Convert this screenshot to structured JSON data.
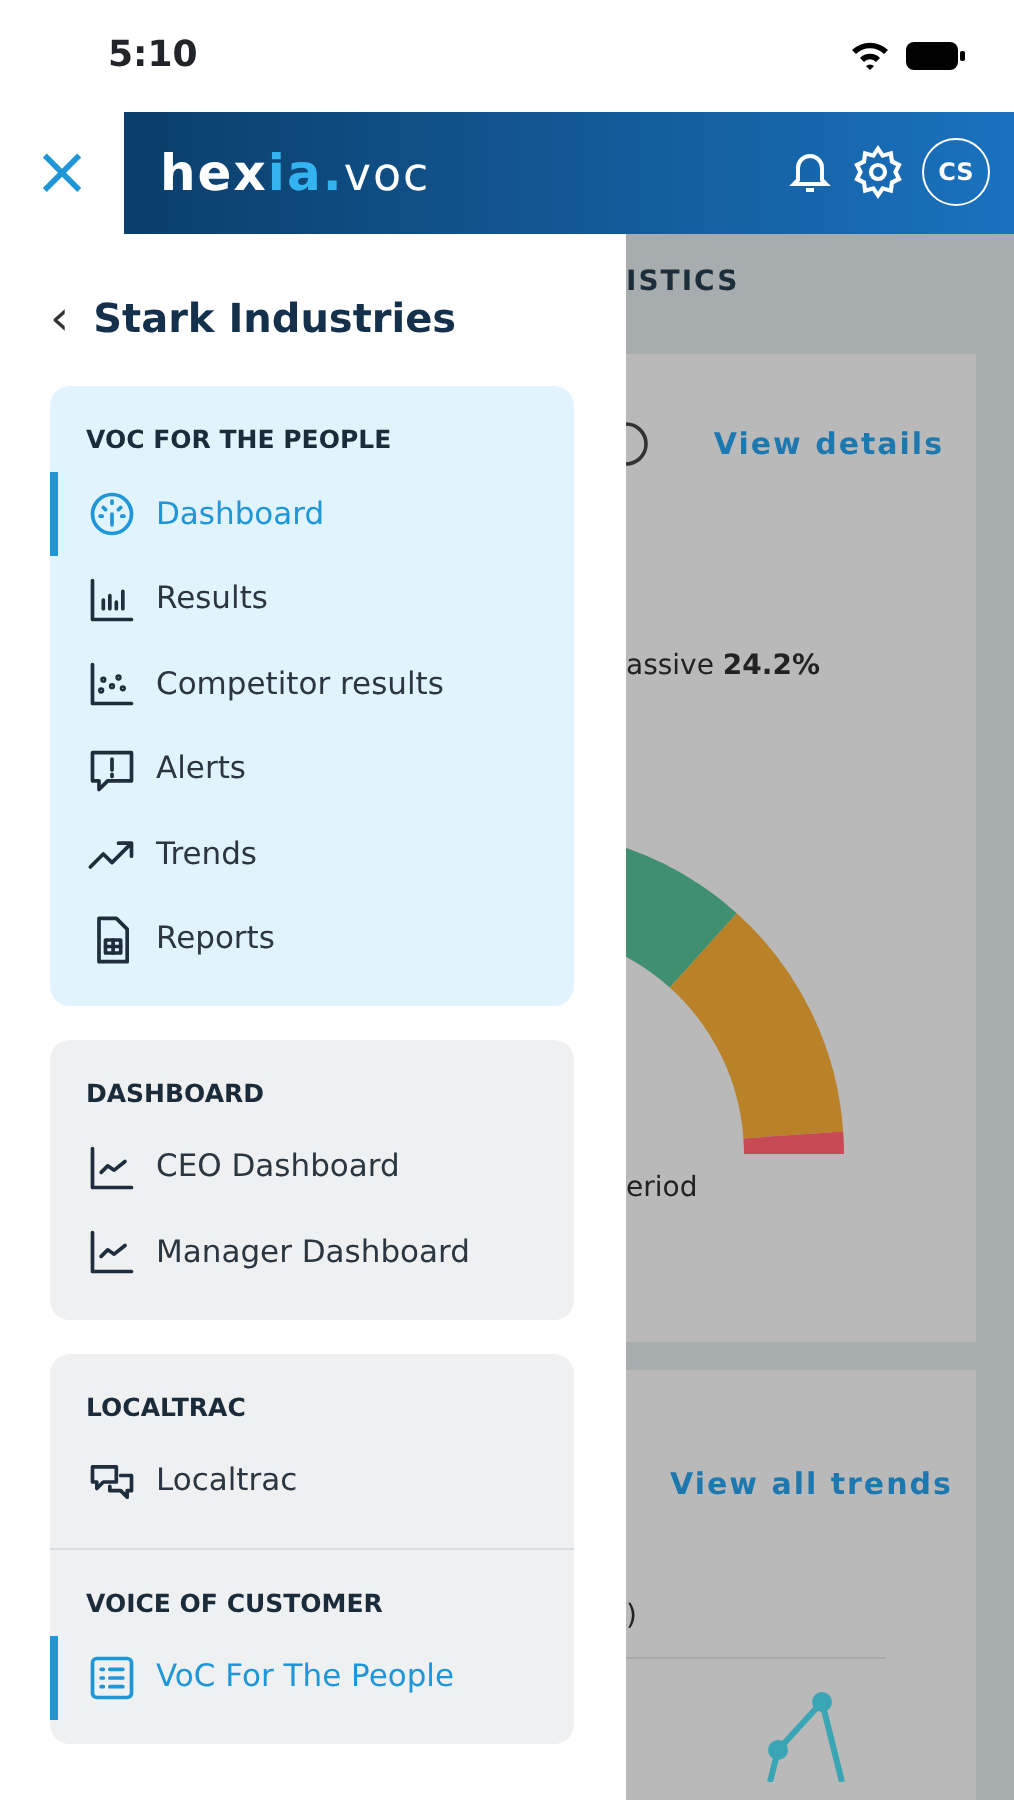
{
  "status_bar": {
    "time": "5:10"
  },
  "header": {
    "close": "×",
    "logo": {
      "main": "hex",
      "accent": "ia.",
      "suffix": "voc"
    },
    "avatar": "CS"
  },
  "drawer": {
    "back": "‹",
    "title": "Stark Industries",
    "cards": [
      {
        "active": true,
        "groups": [
          {
            "heading": "VOC FOR THE PEOPLE",
            "items": [
              {
                "label": "Dashboard",
                "kind": "gauge",
                "selected": true
              },
              {
                "label": "Results",
                "kind": "bars",
                "selected": false
              },
              {
                "label": "Competitor results",
                "kind": "scatter",
                "selected": false
              },
              {
                "label": "Alerts",
                "kind": "alert",
                "selected": false
              },
              {
                "label": "Trends",
                "kind": "trend",
                "selected": false
              },
              {
                "label": "Reports",
                "kind": "report",
                "selected": false
              }
            ]
          }
        ]
      },
      {
        "active": false,
        "groups": [
          {
            "heading": "DASHBOARD",
            "items": [
              {
                "label": "CEO Dashboard",
                "kind": "line",
                "selected": false
              },
              {
                "label": "Manager Dashboard",
                "kind": "line",
                "selected": false
              }
            ]
          }
        ]
      },
      {
        "active": false,
        "groups": [
          {
            "heading": "LOCALTRAC",
            "items": [
              {
                "label": "Localtrac",
                "kind": "chat",
                "selected": false
              }
            ]
          },
          {
            "heading": "VOICE OF CUSTOMER",
            "items": [
              {
                "label": "VoC For The People",
                "kind": "list",
                "selected": true
              }
            ]
          }
        ]
      }
    ]
  },
  "background": {
    "section_title": "ISTICS",
    "score_card": {
      "link": "View details",
      "stat": "assive **24.2%**",
      "footnote": "eriod"
    },
    "trend_card": {
      "link": "View all trends",
      "legend": ")"
    }
  }
}
